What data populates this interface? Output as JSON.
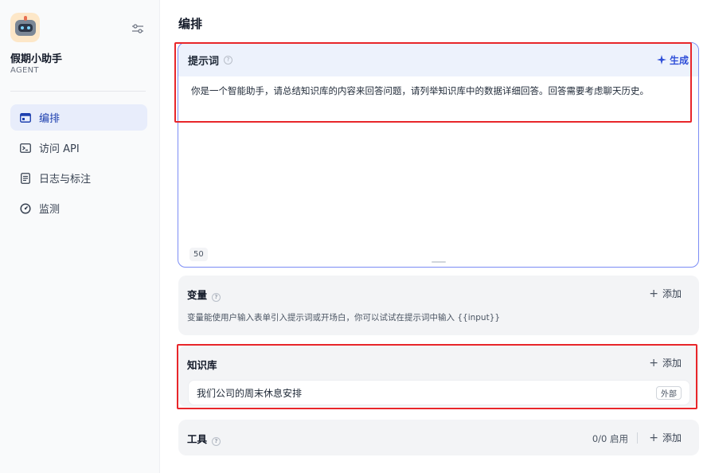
{
  "app": {
    "name": "假期小助手",
    "type": "AGENT"
  },
  "nav": {
    "items": [
      {
        "label": "编排",
        "icon": "window-layout-icon",
        "active": true
      },
      {
        "label": "访问 API",
        "icon": "terminal-icon",
        "active": false
      },
      {
        "label": "日志与标注",
        "icon": "document-icon",
        "active": false
      },
      {
        "label": "监测",
        "icon": "gauge-icon",
        "active": false
      }
    ]
  },
  "page": {
    "title": "编排"
  },
  "prompt": {
    "title": "提示词",
    "generate_label": "生成",
    "text": "你是一个智能助手，请总结知识库的内容来回答问题，请列举知识库中的数据详细回答。回答需要考虑聊天历史。",
    "char_count": "50"
  },
  "variables": {
    "title": "变量",
    "add_label": "添加",
    "description": "变量能使用户输入表单引入提示词或开场白，你可以试试在提示词中输入 {{input}}"
  },
  "knowledge": {
    "title": "知识库",
    "add_label": "添加",
    "items": [
      {
        "name": "我们公司的周末休息安排",
        "tag": "外部"
      }
    ]
  },
  "tools": {
    "title": "工具",
    "enabled_count": "0/0 启用",
    "add_label": "添加"
  },
  "colors": {
    "accent": "#2f4fd8",
    "highlight_border": "#e8262a",
    "prompt_border": "#7b8cf5",
    "active_nav_bg": "#e8edfb"
  }
}
